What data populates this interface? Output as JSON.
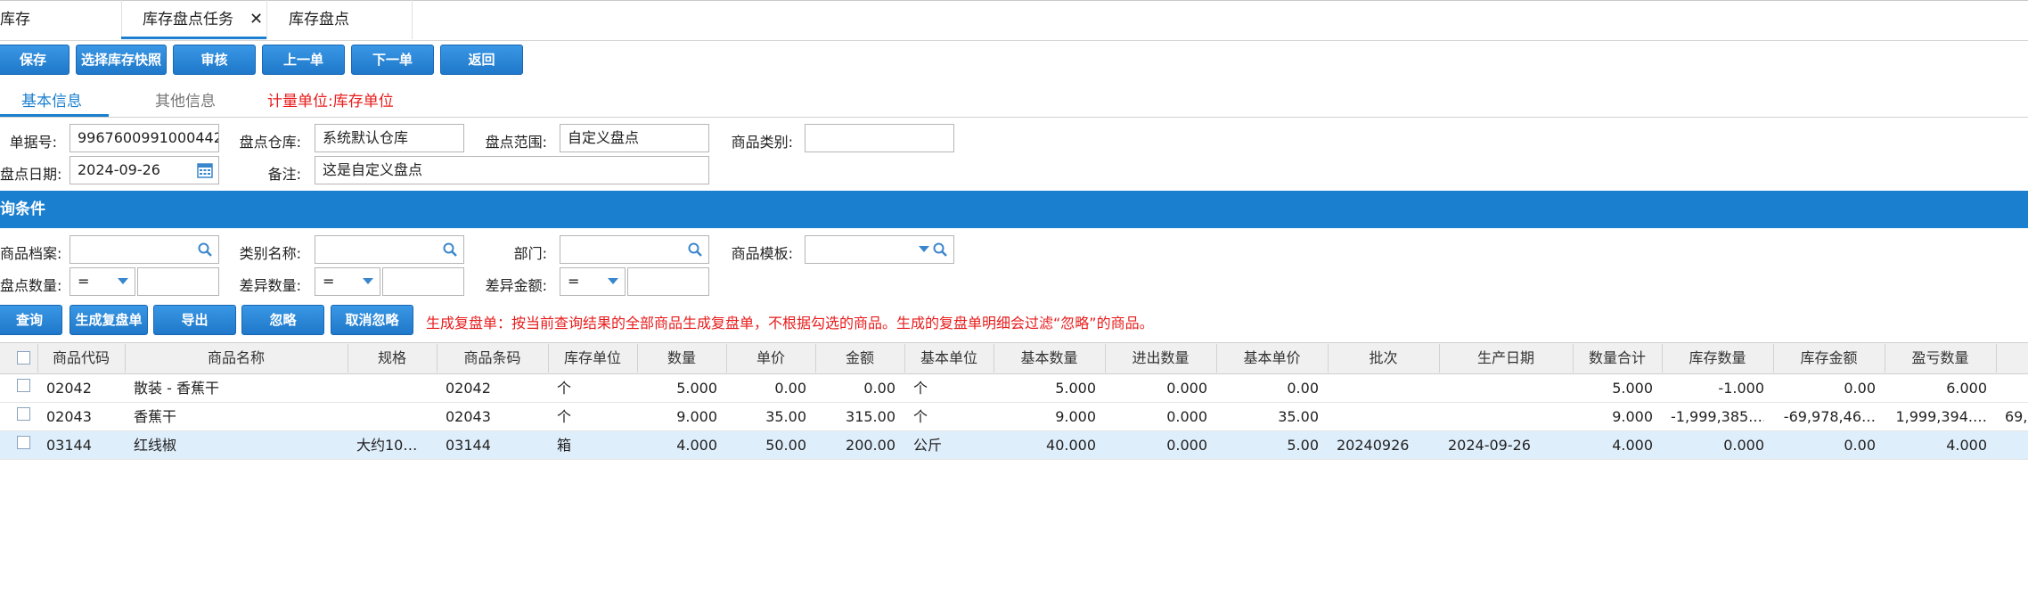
{
  "tabs": [
    {
      "label": "库存"
    },
    {
      "label": "库存盘点任务",
      "active": true
    },
    {
      "label": "库存盘点"
    }
  ],
  "toolbar": {
    "save": "保存",
    "select_snapshot": "选择库存快照",
    "audit": "审核",
    "prev": "上一单",
    "next": "下一单",
    "back": "返回"
  },
  "subtabs": {
    "basic": "基本信息",
    "other": "其他信息",
    "unit_notice": "计量单位:库存单位"
  },
  "form": {
    "doc_no_label": "单据号:",
    "doc_no": "9967600991000442",
    "warehouse_label": "盘点仓库:",
    "warehouse": "系统默认仓库",
    "scope_label": "盘点范围:",
    "scope": "自定义盘点",
    "category_label": "商品类别:",
    "category": "",
    "date_label": "盘点日期:",
    "date": "2024-09-26",
    "remark_label": "备注:",
    "remark": "这是自定义盘点"
  },
  "query": {
    "title": "询条件",
    "product_label": "商品档案:",
    "category_name_label": "类别名称:",
    "dept_label": "部门:",
    "template_label": "商品模板:",
    "count_qty_label": "盘点数量:",
    "count_qty_op": "=",
    "diff_qty_label": "差异数量:",
    "diff_qty_op": "=",
    "diff_amt_label": "差异金额:",
    "diff_amt_op": "="
  },
  "actions": {
    "query": "查询",
    "generate": "生成复盘单",
    "export": "导出",
    "ignore": "忽略",
    "unignore": "取消忽略",
    "note": "生成复盘单：按当前查询结果的全部商品生成复盘单，不根据勾选的商品。生成的复盘单明细会过滤“忽略”的商品。"
  },
  "table": {
    "columns": [
      "商品代码",
      "商品名称",
      "规格",
      "商品条码",
      "库存单位",
      "数量",
      "单价",
      "金额",
      "基本单位",
      "基本数量",
      "进出数量",
      "基本单价",
      "批次",
      "生产日期",
      "数量合计",
      "库存数量",
      "库存金额",
      "盈亏数量"
    ],
    "rows": [
      {
        "code": "02042",
        "name": "散装 - 香蕉干",
        "spec": "",
        "barcode": "02042",
        "unit": "个",
        "qty": "5.000",
        "price": "0.00",
        "amount": "0.00",
        "base_unit": "个",
        "base_qty": "5.000",
        "io_qty": "0.000",
        "base_price": "0.00",
        "batch": "",
        "mfg_date": "",
        "qty_total": "5.000",
        "stock_qty": "-1.000",
        "stock_amt": "0.00",
        "pl_qty": "6.000",
        "extra": ""
      },
      {
        "code": "02043",
        "name": "香蕉干",
        "spec": "",
        "barcode": "02043",
        "unit": "个",
        "qty": "9.000",
        "price": "35.00",
        "amount": "315.00",
        "base_unit": "个",
        "base_qty": "9.000",
        "io_qty": "0.000",
        "base_price": "35.00",
        "batch": "",
        "mfg_date": "",
        "qty_total": "9.000",
        "stock_qty": "-1,999,385.…",
        "stock_amt": "-69,978,46…",
        "pl_qty": "1,999,394.…",
        "extra": "69,"
      },
      {
        "code": "03144",
        "name": "红线椒",
        "spec": "大约10…",
        "barcode": "03144",
        "unit": "箱",
        "qty": "4.000",
        "price": "50.00",
        "amount": "200.00",
        "base_unit": "公斤",
        "base_qty": "40.000",
        "io_qty": "0.000",
        "base_price": "5.00",
        "batch": "20240926",
        "mfg_date": "2024-09-26",
        "qty_total": "4.000",
        "stock_qty": "0.000",
        "stock_amt": "0.00",
        "pl_qty": "4.000",
        "extra": ""
      }
    ]
  },
  "colors": {
    "accent": "#1a7fcf",
    "warning": "#e81c1c",
    "row_highlight": "#dfeefb"
  }
}
